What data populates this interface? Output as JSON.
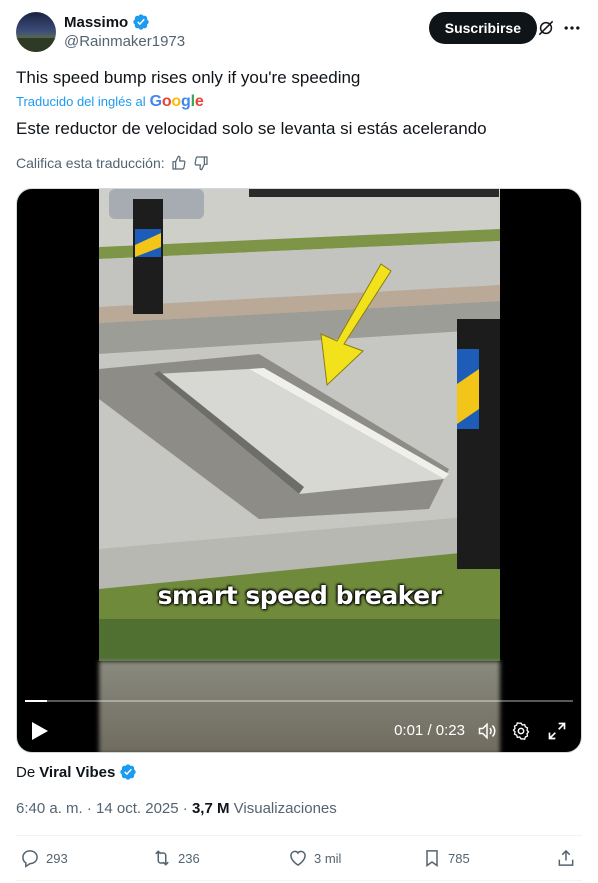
{
  "author": {
    "display_name": "Massimo",
    "handle": "@Rainmaker1973",
    "verified": true
  },
  "header": {
    "subscribe_label": "Suscribirse",
    "icons": [
      "grok-icon",
      "more-icon"
    ]
  },
  "tweet": {
    "text": "This speed bump rises only if you're speeding",
    "translated_from": "Traducido del inglés al",
    "translator": "Google",
    "translation": "Este reductor de velocidad solo se levanta si estás acelerando",
    "rate_label": "Califica esta traducción:"
  },
  "video": {
    "caption": "smart speed breaker",
    "current_time": "0:01",
    "separator": "/",
    "duration": "0:23",
    "progress_fraction": 0.04
  },
  "source": {
    "prefix": "De",
    "name": "Viral Vibes"
  },
  "meta": {
    "time": "6:40 a. m.",
    "dot1": "·",
    "date": "14 oct. 2025",
    "dot2": "·",
    "views_count": "3,7 M",
    "views_label": "Visualizaciones"
  },
  "actions": {
    "replies": "293",
    "reposts": "236",
    "likes": "3 mil",
    "bookmarks": "785"
  },
  "colors": {
    "accent": "#1d9bf0",
    "text": "#0f1419",
    "muted": "#536471",
    "arrow": "#f2e21b"
  }
}
